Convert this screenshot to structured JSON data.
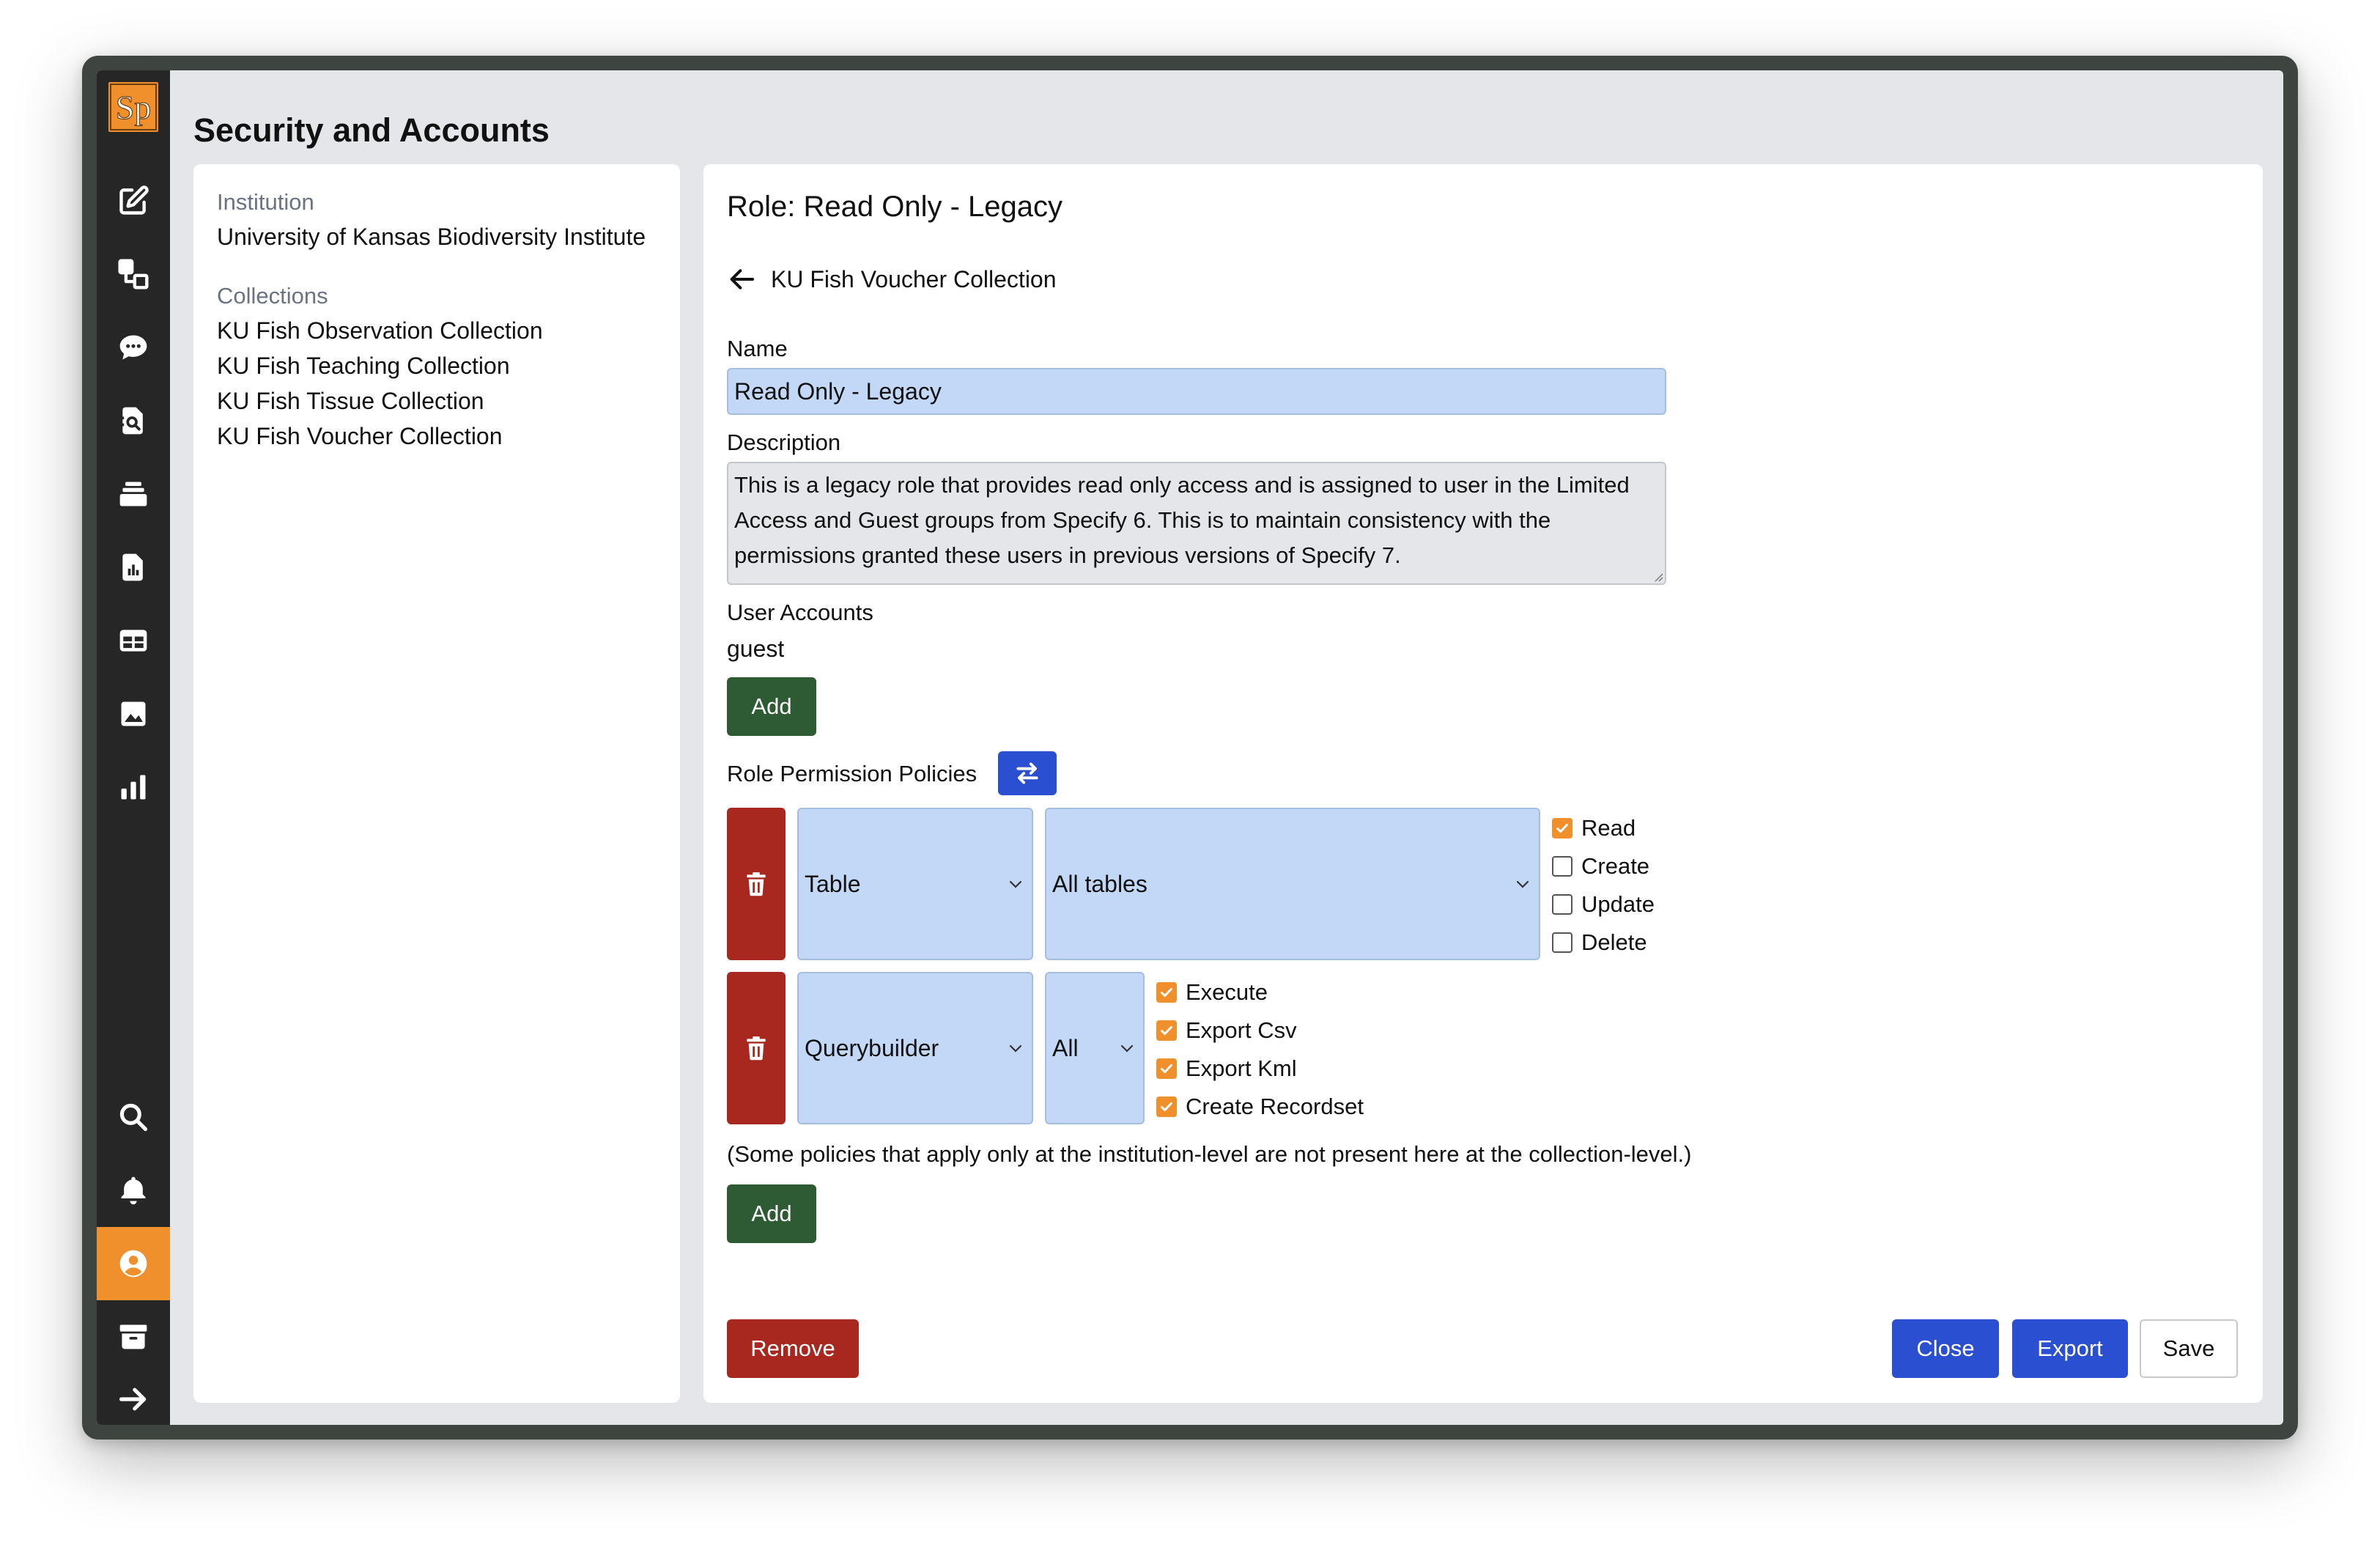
{
  "app": {
    "logo_text": "Sp",
    "page_title": "Security and Accounts",
    "accent_color": "#f0902d"
  },
  "sidebar": {
    "items": [
      {
        "icon": "edit-icon",
        "label": "Data Entry"
      },
      {
        "icon": "interactions-icon",
        "label": "Interactions"
      },
      {
        "icon": "chat-icon",
        "label": "Messages"
      },
      {
        "icon": "query-icon",
        "label": "Queries"
      },
      {
        "icon": "recordsets-icon",
        "label": "Record Sets"
      },
      {
        "icon": "reports-icon",
        "label": "Reports"
      },
      {
        "icon": "workbench-icon",
        "label": "WorkBench"
      },
      {
        "icon": "attachments-icon",
        "label": "Attachments"
      },
      {
        "icon": "stats-icon",
        "label": "Statistics"
      },
      {
        "icon": "search-icon",
        "label": "Search"
      },
      {
        "icon": "bell-icon",
        "label": "Notifications"
      },
      {
        "icon": "user-icon",
        "label": "User Tools",
        "active": true
      },
      {
        "icon": "archive-icon",
        "label": "Collections"
      },
      {
        "icon": "arrow-right-icon",
        "label": "Log Out"
      }
    ]
  },
  "left_panel": {
    "institution_label": "Institution",
    "institution_name": "University of Kansas Biodiversity Institute",
    "collections_label": "Collections",
    "collections": [
      "KU Fish Observation Collection",
      "KU Fish Teaching Collection",
      "KU Fish Tissue Collection",
      "KU Fish Voucher Collection"
    ]
  },
  "role": {
    "title": "Role: Read Only - Legacy",
    "back_label": "KU Fish Voucher Collection",
    "name_label": "Name",
    "name_value": "Read Only - Legacy",
    "description_label": "Description",
    "description_value": "This is a legacy role that provides read only access and is assigned to user in the Limited Access and Guest groups from Specify 6. This is to maintain consistency with the permissions granted these users in previous versions of Specify 7.",
    "user_accounts_label": "User Accounts",
    "users": [
      "guest"
    ],
    "add_user_label": "Add",
    "policies_label": "Role Permission Policies",
    "policies": [
      {
        "category": "Table",
        "resource": "All tables",
        "actions": [
          {
            "label": "Read",
            "checked": true
          },
          {
            "label": "Create",
            "checked": false
          },
          {
            "label": "Update",
            "checked": false
          },
          {
            "label": "Delete",
            "checked": false
          }
        ]
      },
      {
        "category": "Querybuilder",
        "resource": "All",
        "actions": [
          {
            "label": "Execute",
            "checked": true
          },
          {
            "label": "Export Csv",
            "checked": true
          },
          {
            "label": "Export Kml",
            "checked": true
          },
          {
            "label": "Create Recordset",
            "checked": true
          }
        ]
      }
    ],
    "institution_note": "(Some policies that apply only at the institution-level are not present here at the collection-level.)",
    "add_policy_label": "Add"
  },
  "footer": {
    "remove_label": "Remove",
    "close_label": "Close",
    "export_label": "Export",
    "save_label": "Save"
  }
}
